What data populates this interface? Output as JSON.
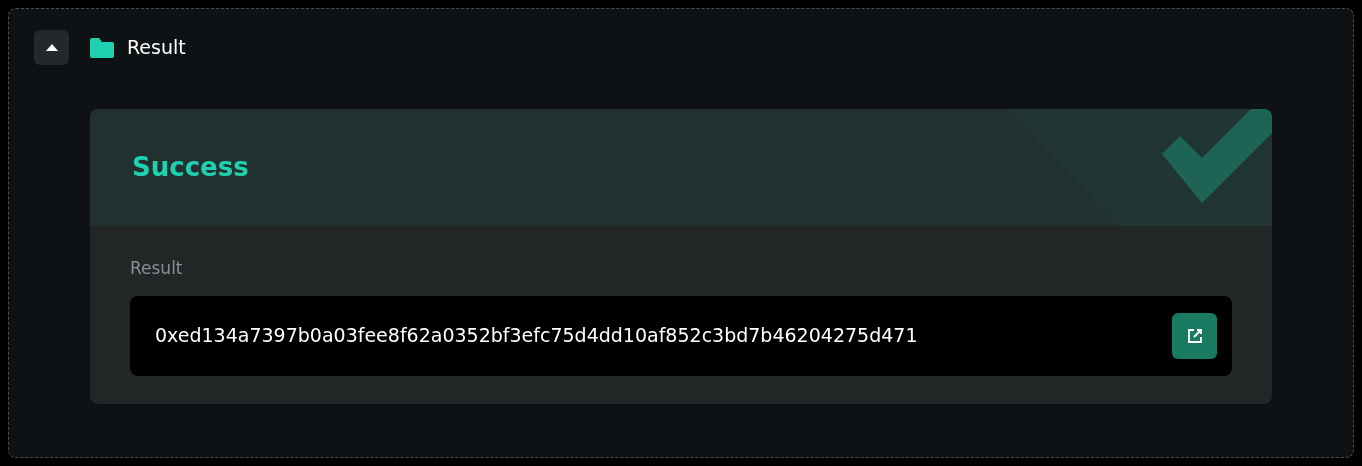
{
  "section": {
    "title": "Result",
    "expanded": true
  },
  "status": {
    "title": "Success",
    "kind": "success"
  },
  "result": {
    "label": "Result",
    "value": "0xed134a7397b0a03fee8f62a0352bf3efc75d4dd10af852c3bd7b46204275d471"
  }
}
